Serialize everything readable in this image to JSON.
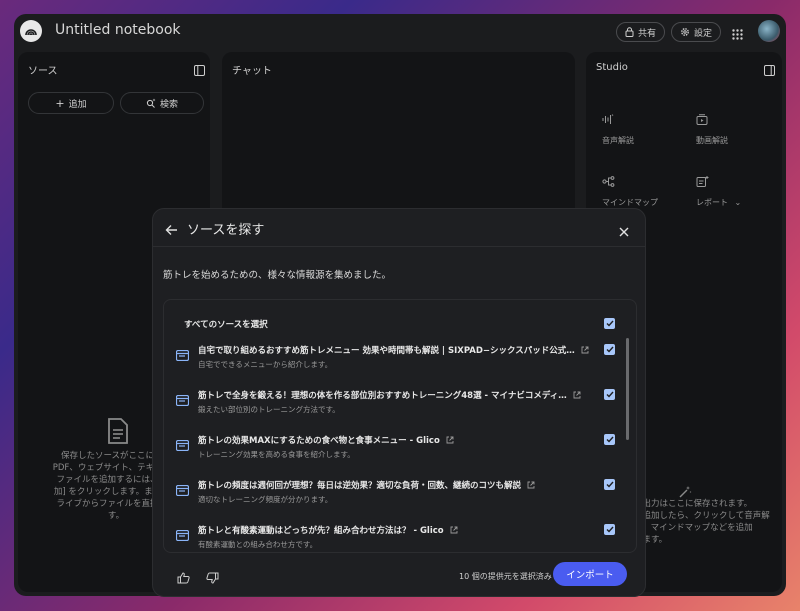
{
  "app": {
    "title": "Untitled notebook",
    "share_label": "共有",
    "settings_label": "設定"
  },
  "sources_panel": {
    "title": "ソース",
    "add_label": "追加",
    "search_label": "検索",
    "empty_text": "保存したソースがここに表示\nPDF、ウェブサイト、テキスト、\nファイルを追加するには、上の\n加] をクリックします。または、\nライブからファイルを直接イン\nす。"
  },
  "chat_panel": {
    "title": "チャット"
  },
  "studio_panel": {
    "title": "Studio",
    "items": [
      {
        "label": "音声解説",
        "icon": "audio-waveform-icon"
      },
      {
        "label": "動画解説",
        "icon": "video-icon"
      },
      {
        "label": "マインドマップ",
        "icon": "mind-map-icon"
      },
      {
        "label": "レポート",
        "icon": "report-icon"
      }
    ],
    "empty_text": "の出力はここに保存されます。\nを追加したら、クリックして音声解\nド、マインドマップなどを追加\nします。"
  },
  "modal": {
    "title": "ソースを探す",
    "description": "筋トレを始めるための、様々な情報源を集めました。",
    "select_all_label": "すべてのソースを選択",
    "sources": [
      {
        "title": "自宅で取り組めるおすすめ筋トレメニュー 効果や時間帯も解説 | SIXPAD−シックスパッド公式…",
        "subtitle": "自宅でできるメニューから紹介します。",
        "checked": true
      },
      {
        "title": "筋トレで全身を鍛える！理想の体を作る部位別おすすめトレーニング48選 - マイナビコメディ…",
        "subtitle": "鍛えたい部位別のトレーニング方法です。",
        "checked": true
      },
      {
        "title": "筋トレの効果MAXにするための食べ物と食事メニュー - Glico",
        "subtitle": "トレーニング効果を高める食事を紹介します。",
        "checked": true
      },
      {
        "title": "筋トレの頻度は週何回が理想？毎日は逆効果？適切な負荷・回数、継続のコツも解説",
        "subtitle": "適切なトレーニング頻度が分かります。",
        "checked": true
      },
      {
        "title": "筋トレと有酸素運動はどっちが先？組み合わせ方法は？ - Glico",
        "subtitle": "有酸素運動との組み合わせ方です。",
        "checked": true
      }
    ],
    "selected_count": "10 個の提供元を選択済み",
    "import_label": "インポート"
  },
  "colors": {
    "accent": "#4a5cf0",
    "checkbox": "#a8c7fa",
    "panel_bg": "#131416",
    "window_bg": "#1b1c1e"
  }
}
